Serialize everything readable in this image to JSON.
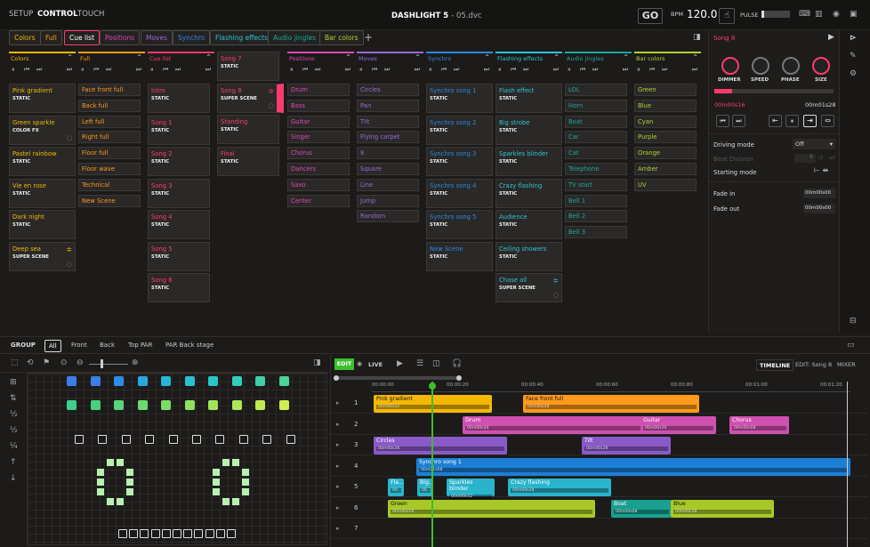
{
  "topbar": {
    "tabs": [
      "SETUP",
      "CONTROL",
      "TOUCH"
    ],
    "title": "DASHLIGHT 5",
    "file": "- 05.dvc",
    "go": "GO",
    "bpm_label": "BPM",
    "bpm": "120.0",
    "pulse": "PULSE"
  },
  "tabs": [
    "Colors",
    "Full",
    "Cue list",
    "Positions",
    "Moves",
    "Synchro",
    "Flashing effects",
    "Audio jingles",
    "Bar colors"
  ],
  "columns": [
    {
      "name": "Colors",
      "color": "#f5b800",
      "cells": [
        {
          "name": "Pink gradient",
          "sub": "STATIC"
        },
        {
          "name": "Green sparkle",
          "sub": "COLOR FX"
        },
        {
          "name": "Pastel rainbow",
          "sub": "STATIC"
        },
        {
          "name": "Vie en rose",
          "sub": "STATIC"
        },
        {
          "name": "Dark night",
          "sub": "STATIC"
        },
        {
          "name": "Deep sea",
          "sub": "SUPER SCENE"
        }
      ]
    },
    {
      "name": "Full",
      "color": "#ff9a1a",
      "cells": [
        {
          "name": "Face front full"
        },
        {
          "name": "Back full"
        },
        {
          "name": "Left full"
        },
        {
          "name": "Right full"
        },
        {
          "name": "Floor full"
        },
        {
          "name": "Floor wave"
        },
        {
          "name": "Technical"
        },
        {
          "name": "New Scene"
        }
      ]
    },
    {
      "name": "Cue list",
      "color": "#ff3a6e",
      "cells": [
        {
          "name": "Intro",
          "sub": "STATIC"
        },
        {
          "name": "Song 1",
          "sub": "STATIC"
        },
        {
          "name": "Song 2",
          "sub": "STATIC"
        },
        {
          "name": "Song 3",
          "sub": "STATIC"
        },
        {
          "name": "Song 4",
          "sub": "STATIC"
        },
        {
          "name": "Song 5",
          "sub": "STATIC"
        },
        {
          "name": "Song 6",
          "sub": "STATIC"
        }
      ],
      "col2": [
        {
          "name": "Song 7",
          "sub": "STATIC"
        },
        {
          "name": "Song 8",
          "sub": "SUPER SCENE"
        },
        {
          "name": "Standing",
          "sub": "STATIC"
        },
        {
          "name": "Final",
          "sub": "STATIC"
        }
      ]
    },
    {
      "name": "Positions",
      "color": "#e048b8",
      "cells": [
        {
          "name": "Drum"
        },
        {
          "name": "Bass"
        },
        {
          "name": "Guitar"
        },
        {
          "name": "Singer"
        },
        {
          "name": "Chorus"
        },
        {
          "name": "Dancers"
        },
        {
          "name": "Saxo"
        },
        {
          "name": "Center"
        }
      ]
    },
    {
      "name": "Moves",
      "color": "#9a6ad6",
      "cells": [
        {
          "name": "Circles"
        },
        {
          "name": "Pan"
        },
        {
          "name": "Tilt"
        },
        {
          "name": "Flying carpet"
        },
        {
          "name": "8"
        },
        {
          "name": "Square"
        },
        {
          "name": "Line"
        },
        {
          "name": "Jump"
        },
        {
          "name": "Random"
        }
      ]
    },
    {
      "name": "Synchro",
      "color": "#2e88e0",
      "cells": [
        {
          "name": "Synchro song 1",
          "sub": "STATIC"
        },
        {
          "name": "Synchro song 2",
          "sub": "STATIC"
        },
        {
          "name": "Synchro song 3",
          "sub": "STATIC"
        },
        {
          "name": "Synchro song 4",
          "sub": "STATIC"
        },
        {
          "name": "Synchro song 5",
          "sub": "STATIC"
        },
        {
          "name": "New Scene",
          "sub": "STATIC"
        }
      ]
    },
    {
      "name": "Flashing effects",
      "color": "#2ec4d8",
      "cells": [
        {
          "name": "Flash effect",
          "sub": "STATIC"
        },
        {
          "name": "Big strobe",
          "sub": "STATIC"
        },
        {
          "name": "Sparkles blinder",
          "sub": "STATIC"
        },
        {
          "name": "Crazy flashing",
          "sub": "STATIC"
        },
        {
          "name": "Audience",
          "sub": "STATIC"
        },
        {
          "name": "Ceiling showers",
          "sub": "STATIC"
        },
        {
          "name": "Chase all",
          "sub": "SUPER SCENE"
        }
      ]
    },
    {
      "name": "Audio jingles",
      "color": "#1aa89a",
      "cells": [
        {
          "name": "LOL"
        },
        {
          "name": "Horn"
        },
        {
          "name": "Boat"
        },
        {
          "name": "Car"
        },
        {
          "name": "Cat"
        },
        {
          "name": "Telephone"
        },
        {
          "name": "TV start"
        },
        {
          "name": "Bell 1"
        },
        {
          "name": "Bell 2"
        },
        {
          "name": "Bell 3"
        }
      ]
    },
    {
      "name": "Bar colors",
      "color": "#b4d232",
      "cells": [
        {
          "name": "Green"
        },
        {
          "name": "Blue"
        },
        {
          "name": "Cyan"
        },
        {
          "name": "Purple"
        },
        {
          "name": "Orange"
        },
        {
          "name": "Amber"
        },
        {
          "name": "UV"
        }
      ]
    }
  ],
  "right": {
    "title": "Song 8",
    "dials": [
      "DIMMER",
      "SPEED",
      "PHASE",
      "SIZE"
    ],
    "time_start": "00m00s16",
    "time_end": "00m01s28",
    "driving_mode": "Driving mode",
    "driving_value": "Off",
    "beat_division": "Beat Division",
    "beat_value": "8",
    "beat_opts": [
      "/2",
      "x2"
    ],
    "starting_mode": "Starting mode",
    "fade_in": "Fade in",
    "fade_in_val": "00m00s00",
    "fade_out": "Fade out",
    "fade_out_val": "00m00s00"
  },
  "group": {
    "label": "GROUP",
    "buttons": [
      "All",
      "Front",
      "Back",
      "Top PAR",
      "PAR Back stage"
    ]
  },
  "timeline": {
    "edit": "EDIT",
    "live": "LIVE",
    "tabs": [
      "TIMELINE",
      "EDIT: Song 8",
      "MIXER"
    ],
    "ticks": [
      "00:00:00",
      "00:00:20",
      "00:00:40",
      "00:00:60",
      "00:00:80",
      "00:01:00",
      "00:01:20"
    ],
    "rows": [
      "1",
      "2",
      "3",
      "4",
      "5",
      "6",
      "7"
    ],
    "bars": [
      {
        "row": 0,
        "label": "Pink gradient",
        "time": "00m00s32",
        "color": "#f5b800"
      },
      {
        "row": 0,
        "label": "Face front full",
        "time": "00m00s48",
        "color": "#ff9a1a"
      },
      {
        "row": 1,
        "label": "Drum",
        "time": "00m00s44",
        "color": "#d050b0"
      },
      {
        "row": 1,
        "label": "Guitar",
        "time": "00m00s20",
        "color": "#d050b0"
      },
      {
        "row": 1,
        "label": "Chorus",
        "time": "00m00s08",
        "color": "#d050b0"
      },
      {
        "row": 2,
        "label": "Circles",
        "time": "00m00s36",
        "color": "#8a5ac8"
      },
      {
        "row": 2,
        "label": "Tilt",
        "time": "00m00s28",
        "color": "#8a5ac8"
      },
      {
        "row": 3,
        "label": "Synchro song 1",
        "time": "00m01s08",
        "color": "#1c7fd6"
      },
      {
        "row": 4,
        "label": "Fla...",
        "time": "00...",
        "color": "#2ab4cc"
      },
      {
        "row": 4,
        "label": "Big...",
        "time": "00...",
        "color": "#2ab4cc"
      },
      {
        "row": 4,
        "label": "Sparkles blinder",
        "time": "00m00s12",
        "color": "#2ab4cc"
      },
      {
        "row": 4,
        "label": "Crazy flashing",
        "time": "00m00s28",
        "color": "#2ab4cc"
      },
      {
        "row": 5,
        "label": "Green",
        "time": "00m00s56",
        "color": "#a8c828"
      },
      {
        "row": 5,
        "label": "Boat",
        "time": "00m00s08",
        "color": "#18a090"
      },
      {
        "row": 5,
        "label": "Blue",
        "time": "00m00s28",
        "color": "#a8c828"
      }
    ]
  }
}
